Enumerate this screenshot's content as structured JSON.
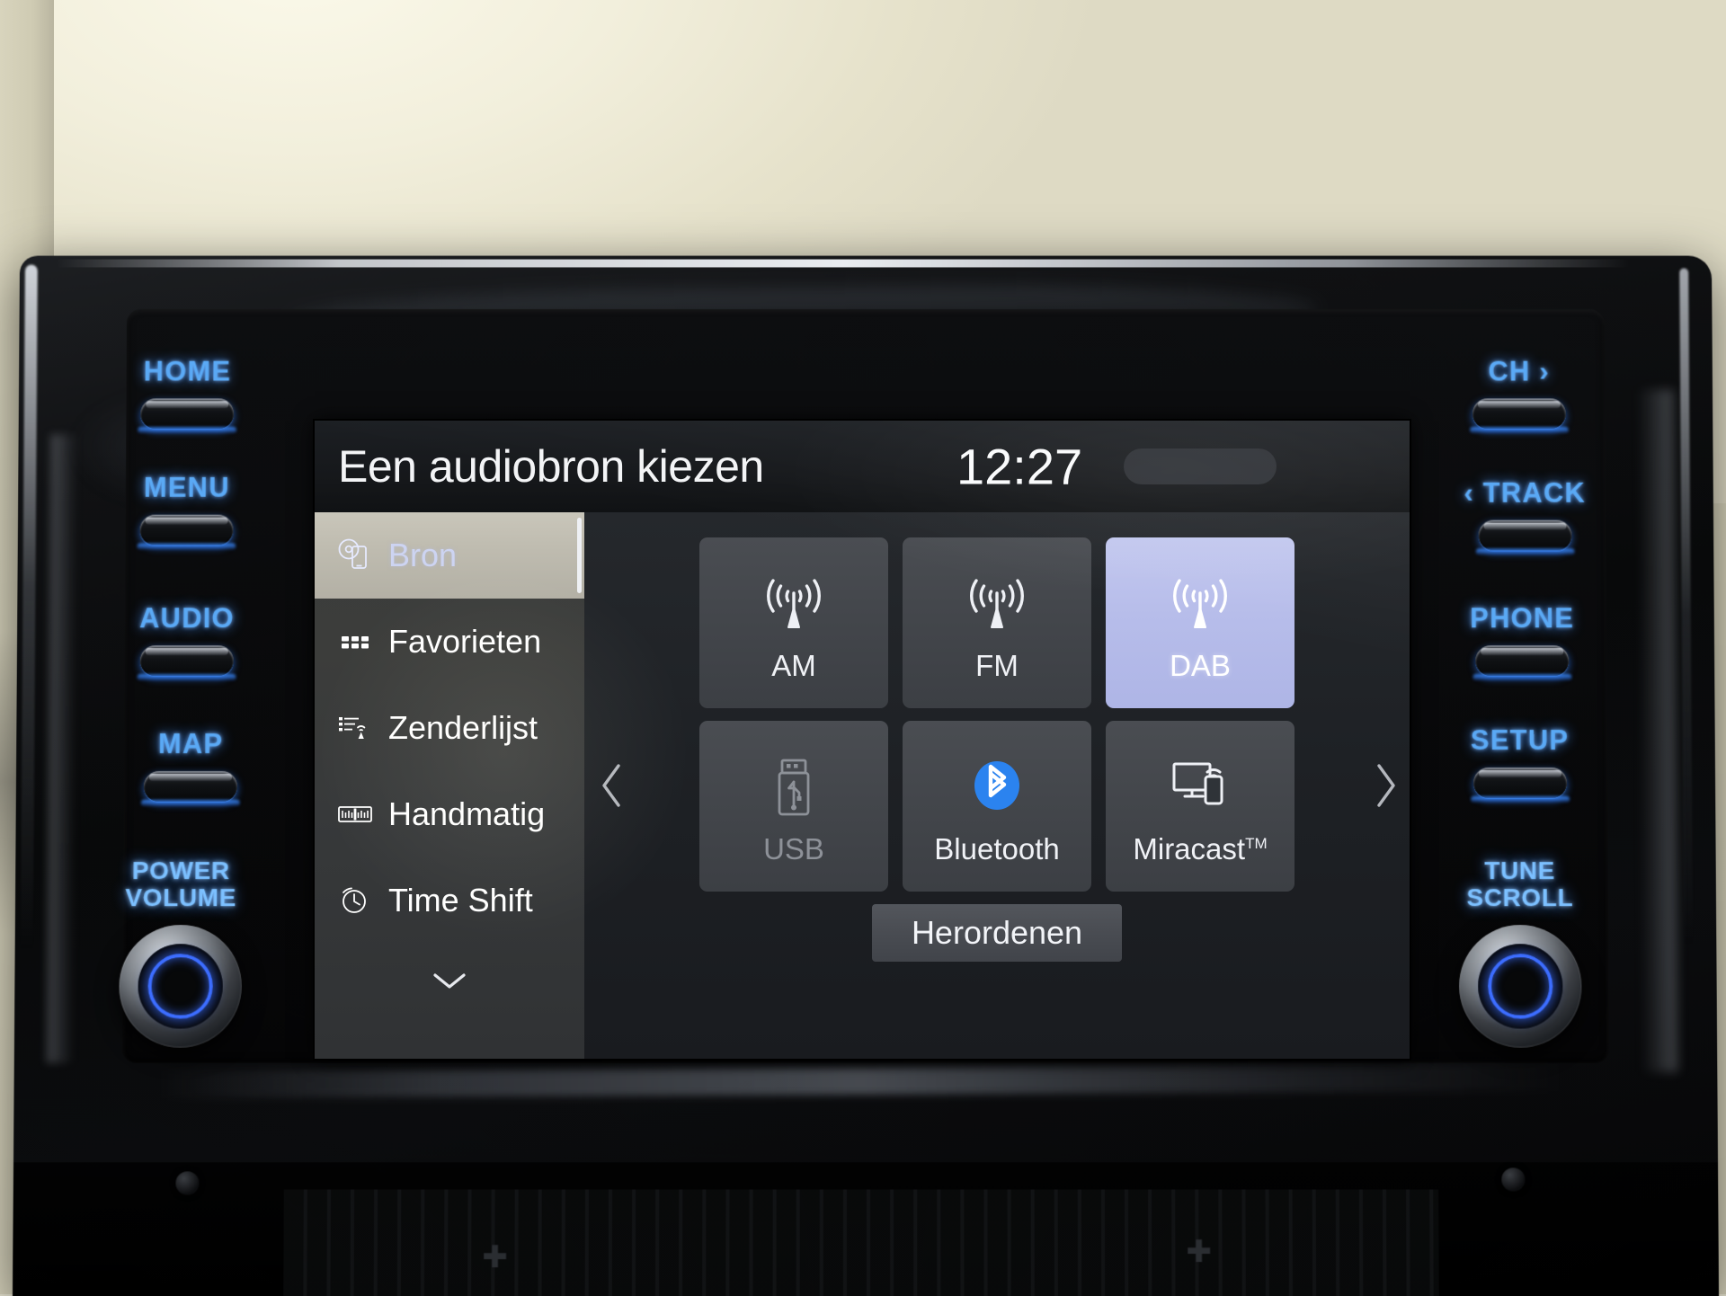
{
  "screen": {
    "title": "Een audiobron kiezen",
    "clock": "12:27",
    "sidebar": [
      {
        "label": "Bron",
        "icon": "disc-phone-icon",
        "selected": true
      },
      {
        "label": "Favorieten",
        "icon": "grid-dots-icon",
        "selected": false
      },
      {
        "label": "Zenderlijst",
        "icon": "station-list-icon",
        "selected": false
      },
      {
        "label": "Handmatig",
        "icon": "tuning-scale-icon",
        "selected": false
      },
      {
        "label": "Time Shift",
        "icon": "clock-icon",
        "selected": false
      }
    ],
    "sidebar_more_icon": "chevron-down-icon",
    "page_prev_icon": "chevron-left-icon",
    "page_next_icon": "chevron-right-icon",
    "tiles": [
      {
        "label": "AM",
        "icon": "radio-antenna-icon",
        "state": "normal"
      },
      {
        "label": "FM",
        "icon": "radio-antenna-icon",
        "state": "normal"
      },
      {
        "label": "DAB",
        "icon": "radio-antenna-icon",
        "state": "active"
      },
      {
        "label": "USB",
        "icon": "usb-stick-icon",
        "state": "disabled"
      },
      {
        "label": "Bluetooth",
        "icon": "bluetooth-icon",
        "state": "normal"
      },
      {
        "label": "Miracast",
        "label_sup": "TM",
        "icon": "screen-cast-icon",
        "state": "normal"
      }
    ],
    "reorder_button": "Herordenen"
  },
  "hardware": {
    "left_buttons": [
      {
        "label": "HOME"
      },
      {
        "label": "MENU"
      },
      {
        "label": "AUDIO"
      },
      {
        "label": "MAP"
      }
    ],
    "right_buttons": [
      {
        "label": "CH ›"
      },
      {
        "label": "‹ TRACK"
      },
      {
        "label": "PHONE"
      },
      {
        "label": "SETUP"
      }
    ],
    "left_knob": {
      "line1": "POWER",
      "line2": "VOLUME"
    },
    "right_knob": {
      "line1": "TUNE",
      "line2": "SCROLL"
    }
  },
  "colors": {
    "button_blue": "#5aa9f5",
    "tile_active_bg": "#b7bdea",
    "bluetooth_blue": "#2b83ef",
    "screen_bg": "#1a1c20"
  }
}
